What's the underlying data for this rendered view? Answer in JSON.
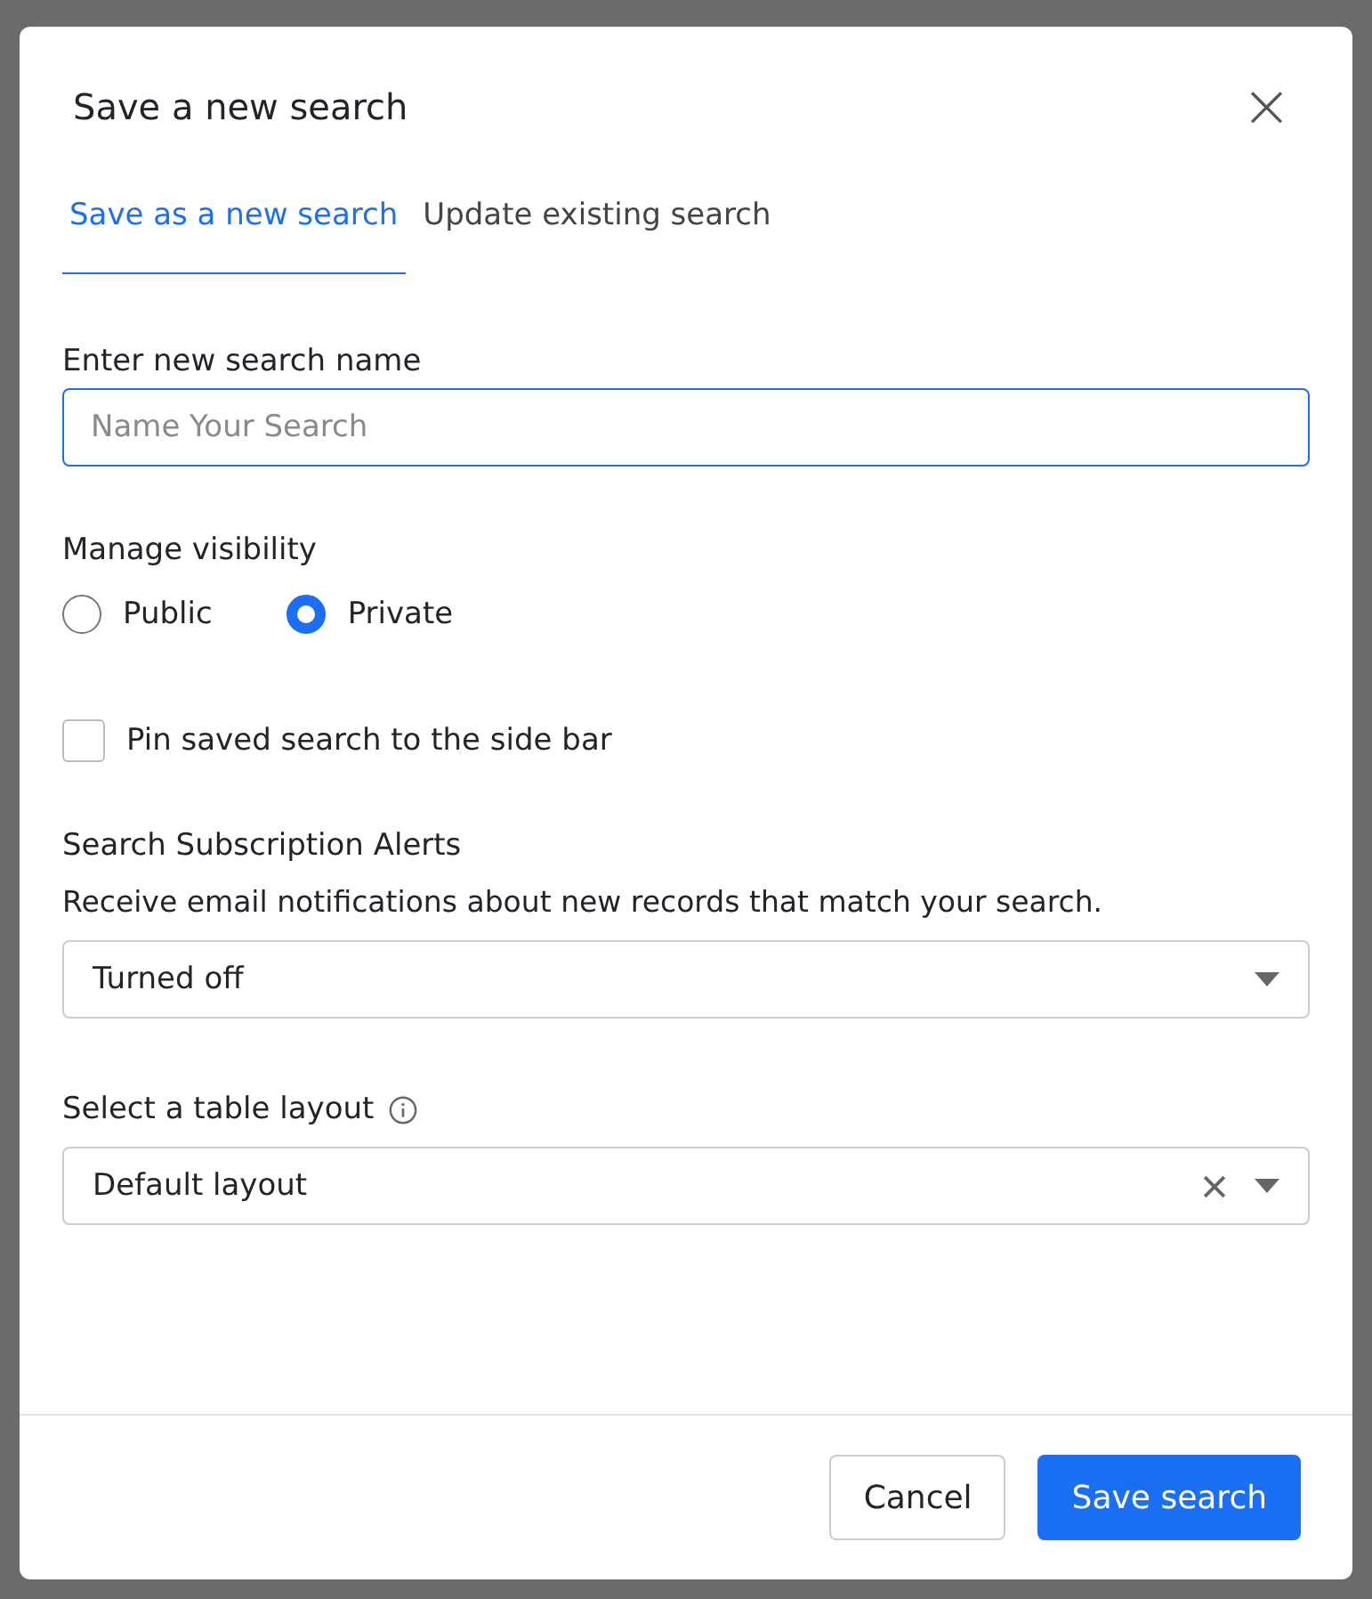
{
  "dialog": {
    "title": "Save a new search",
    "close": "×"
  },
  "tabs": [
    {
      "label": "Save as a new search",
      "selected": true
    },
    {
      "label": "Update existing search",
      "selected": false
    }
  ],
  "name_field": {
    "label": "Enter new search name",
    "placeholder": "Name Your Search"
  },
  "visibility": {
    "label": "Manage visibility",
    "options": [
      {
        "label": "Public",
        "selected": false
      },
      {
        "label": "Private",
        "selected": true
      }
    ]
  },
  "pin": {
    "label": "Pin saved search to the side bar",
    "checked": false
  },
  "alerts": {
    "title": "Search Subscription Alerts",
    "description": "Receive email notifications about new records that match your search.",
    "value": "Turned off"
  },
  "layout": {
    "label": "Select a table layout",
    "value": "Default layout",
    "clearable": true
  },
  "buttons": [
    {
      "label": "Cancel",
      "kind": "secondary"
    },
    {
      "label": "Save search",
      "kind": "primary"
    }
  ]
}
